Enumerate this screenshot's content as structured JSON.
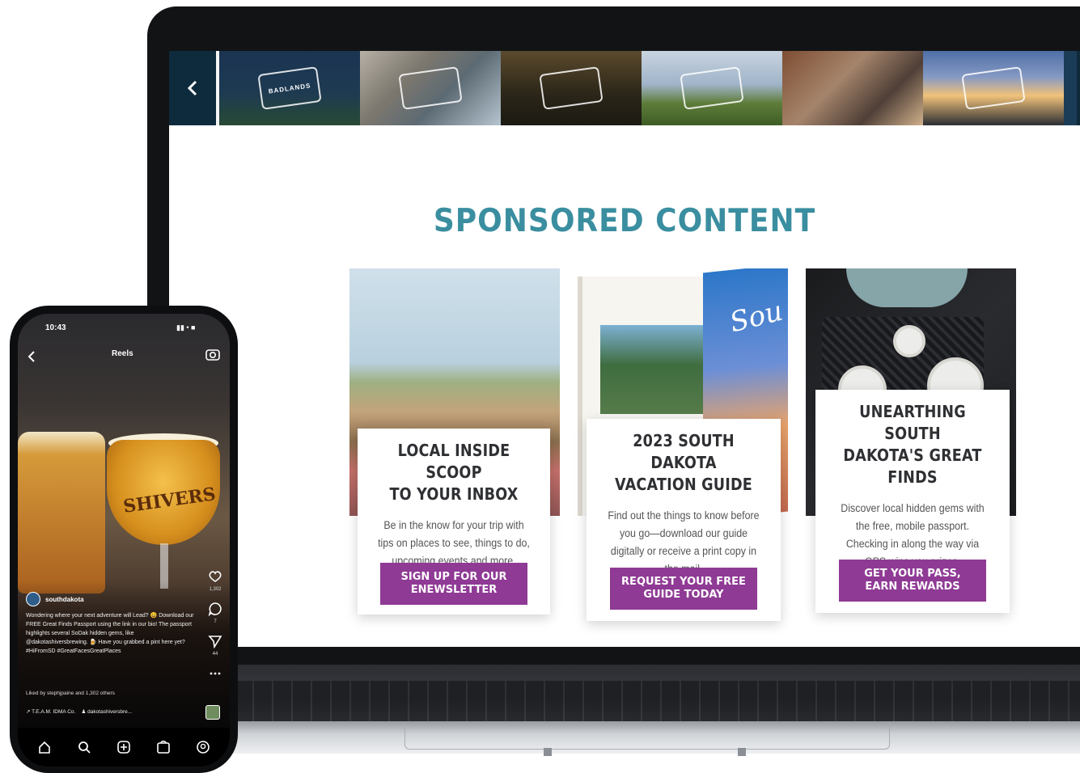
{
  "laptop": {
    "strip": {
      "back_icon": "chevron-left-icon",
      "tiles": [
        {
          "label": "BADLANDS"
        },
        {
          "label": ""
        },
        {
          "label": ""
        },
        {
          "label": ""
        },
        {
          "label": ""
        },
        {
          "label": ""
        }
      ]
    },
    "section_title": "SPONSORED CONTENT",
    "guide_script": "Sou",
    "cards": [
      {
        "title_line1": "LOCAL INSIDE SCOOP",
        "title_line2": "TO YOUR INBOX",
        "body": "Be in the know for your trip with tips on places to see, things to do, upcoming events and more.",
        "button": "SIGN UP FOR OUR ENEWSLETTER"
      },
      {
        "title_line1": "2023 SOUTH DAKOTA",
        "title_line2": "VACATION GUIDE",
        "body": "Find out the things to know before you go—download our guide digitally or receive a print copy in the mail.",
        "button": "REQUEST YOUR FREE GUIDE TODAY"
      },
      {
        "title_line1": "UNEARTHING SOUTH",
        "title_line2": "DAKOTA'S GREAT",
        "title_line3": "FINDS",
        "body": "Discover local hidden gems with the free, mobile passport. Checking in along the way via GPS wins you prizes.",
        "button": "GET YOUR PASS, EARN REWARDS"
      }
    ],
    "accent_color": "#8f3a95",
    "title_color": "#3a8ea0"
  },
  "phone": {
    "time": "10:43",
    "status": "▮▮ • ■",
    "back_icon": "chevron-left-icon",
    "header": "Reels",
    "camera_icon": "camera-icon",
    "glass_text": "SHIVERS",
    "like_count": "1,302",
    "comment_count": "7",
    "share_count": "44",
    "handle": "southdakota",
    "caption": "Wondering where your next adventure will Lead? 😀 Download our FREE Great Finds Passport using the link in our bio! The passport highlights several SoDak hidden gems, like @dakotashiversbrewing. 🍺 Have you grabbed a pint here yet? #HiFromSD #GreatFacesGreatPlaces",
    "liked_by": "Liked by stephjpaine and 1,302 others",
    "audio_left": "↗ T.E.A.M. IDMA Co.",
    "audio_right": "♟ dakotashiversbre...",
    "nav_icons": [
      "home-icon",
      "search-icon",
      "create-icon",
      "shop-icon",
      "profile-icon"
    ]
  }
}
